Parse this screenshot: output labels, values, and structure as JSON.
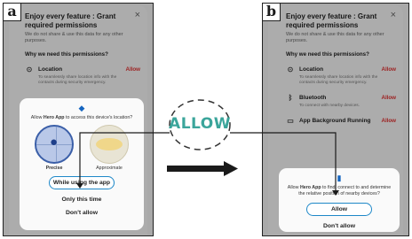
{
  "panel_a": {
    "tag": "a",
    "title": "Enjoy every feature : Grant required permissions",
    "close": "×",
    "desc": "We do not share & use this data for any other purposes.",
    "why": "Why we need this permissions?",
    "perm_location": {
      "name": "Location",
      "allow": "Allow",
      "desc": "To seamlessly share location info with the contacts during security emergency."
    },
    "dialog": {
      "prefix": "Allow ",
      "app": "Hero App",
      "suffix": " to access this device's location?",
      "precise": "Precise",
      "approximate": "Approximate",
      "btn_primary": "While using the app",
      "btn_once": "Only this time",
      "btn_deny": "Don't allow"
    }
  },
  "panel_b": {
    "tag": "b",
    "title": "Enjoy every feature : Grant required permissions",
    "close": "×",
    "desc": "We do not share & use this data for any other purposes.",
    "why": "Why we need this permissions?",
    "perm_location": {
      "name": "Location",
      "allow": "Allow",
      "desc": "To seamlessly share location info with the contacts during security emergency."
    },
    "perm_bluetooth": {
      "name": "Bluetooth",
      "allow": "Allow",
      "desc": "To connect with nearby devices."
    },
    "perm_background": {
      "name": "App Background Running",
      "allow": "Allow"
    },
    "dialog": {
      "prefix": "Allow ",
      "app": "Hero App",
      "suffix": " to find, connect to and determine the relative position of nearby devices?",
      "btn_primary": "Allow",
      "btn_deny": "Don't allow"
    }
  },
  "center": {
    "allow_label": "ALLOW"
  },
  "colors": {
    "highlight": "#1e88c8",
    "allow_red": "#e03030",
    "allow_teal": "#3ba59b"
  }
}
